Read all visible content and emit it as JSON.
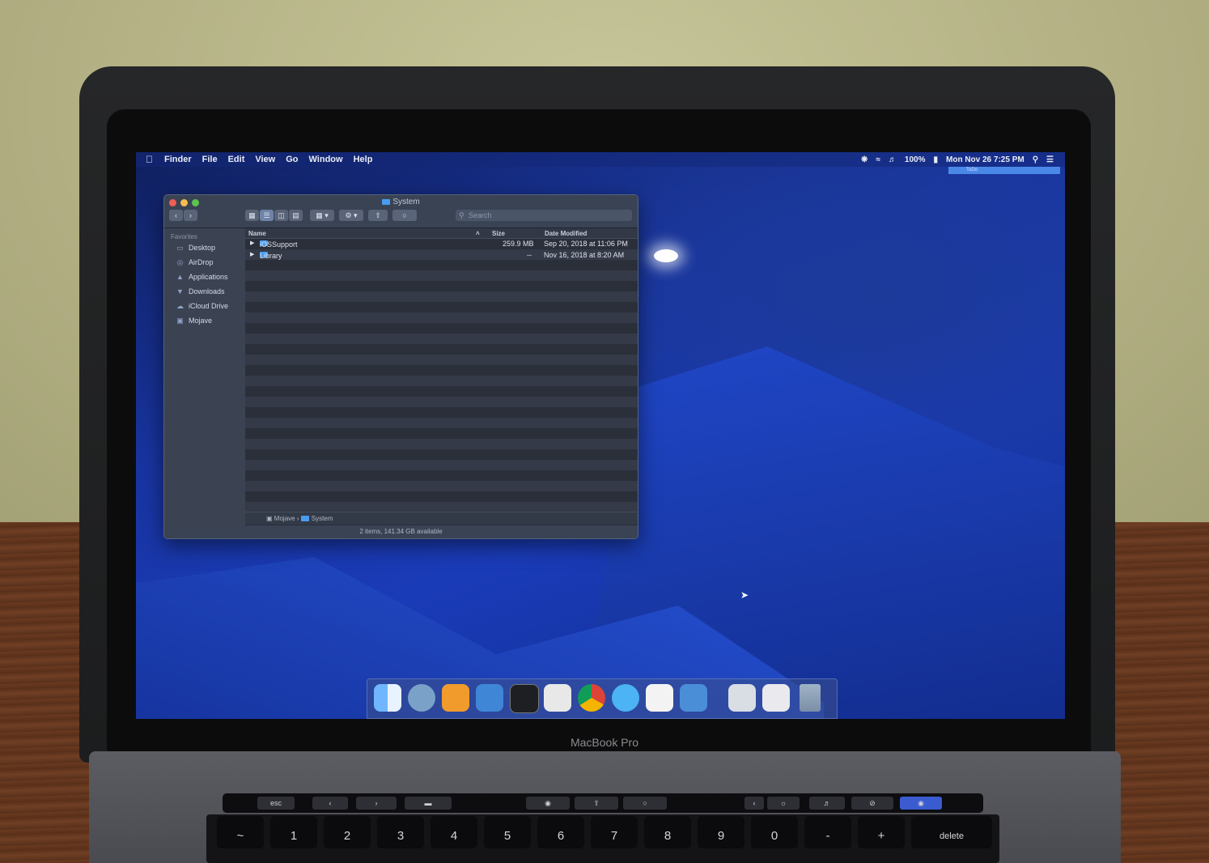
{
  "menubar": {
    "app": "Finder",
    "items": [
      "File",
      "Edit",
      "View",
      "Go",
      "Window",
      "Help"
    ],
    "battery": "100%",
    "clock": "Mon Nov 26  7:25 PM",
    "todo": "ToDo"
  },
  "finder": {
    "title": "System",
    "search_placeholder": "Search",
    "sidebar": {
      "heading": "Favorites",
      "items": [
        "Desktop",
        "AirDrop",
        "Applications",
        "Downloads",
        "iCloud Drive",
        "Mojave"
      ]
    },
    "columns": [
      "Name",
      "Size",
      "Date Modified"
    ],
    "rows": [
      {
        "name": "iOSSupport",
        "size": "259.9 MB",
        "date": "Sep 20, 2018 at 11:06 PM"
      },
      {
        "name": "Library",
        "size": "--",
        "date": "Nov 16, 2018 at 8:20 AM"
      }
    ],
    "path": [
      "Mojave",
      "System"
    ],
    "status": "2 items, 141.34 GB available"
  },
  "laptop": {
    "model_label": "MacBook Pro"
  },
  "touchbar": {
    "esc": "esc"
  },
  "keyboard": {
    "keys": [
      "~",
      "1",
      "2",
      "3",
      "4",
      "5",
      "6",
      "7",
      "8",
      "9",
      "0",
      "-",
      "+"
    ],
    "delete": "delete"
  },
  "colors": {
    "accent": "#4a9cf0",
    "close": "#ee5e56",
    "minimize": "#f5bd4f",
    "zoom": "#5ec44c"
  }
}
